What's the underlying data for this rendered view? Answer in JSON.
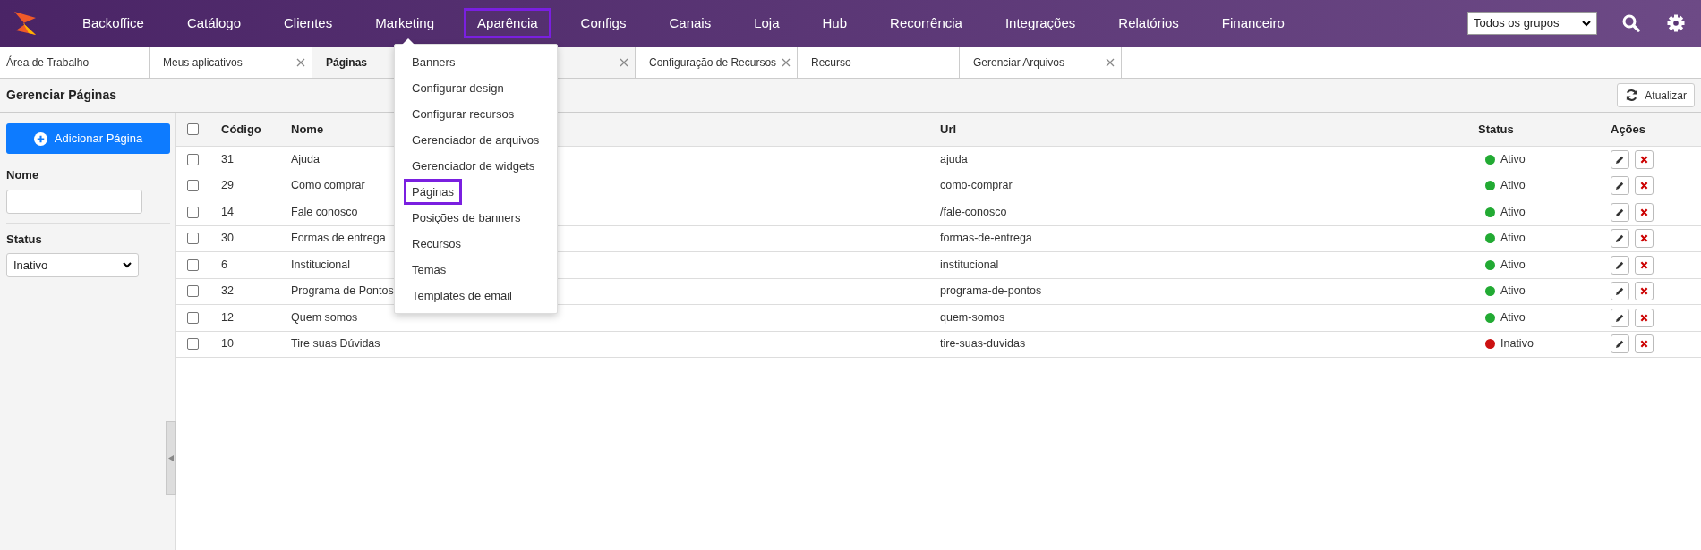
{
  "nav": {
    "items": [
      {
        "label": "Backoffice",
        "selected": false
      },
      {
        "label": "Catálogo",
        "selected": false
      },
      {
        "label": "Clientes",
        "selected": false
      },
      {
        "label": "Marketing",
        "selected": false
      },
      {
        "label": "Aparência",
        "selected": true
      },
      {
        "label": "Configs",
        "selected": false
      },
      {
        "label": "Canais",
        "selected": false
      },
      {
        "label": "Loja",
        "selected": false
      },
      {
        "label": "Hub",
        "selected": false
      },
      {
        "label": "Recorrência",
        "selected": false
      },
      {
        "label": "Integrações",
        "selected": false
      },
      {
        "label": "Relatórios",
        "selected": false
      },
      {
        "label": "Financeiro",
        "selected": false
      }
    ],
    "group_select": "Todos os grupos"
  },
  "tabs": [
    {
      "label": "Área de Trabalho",
      "selected": false,
      "closable": false
    },
    {
      "label": "Meus aplicativos",
      "selected": false,
      "closable": true
    },
    {
      "label": "Páginas",
      "selected": true,
      "closable": true
    },
    {
      "label": "Configuração de Recursos",
      "selected": false,
      "closable": true
    },
    {
      "label": "Recurso",
      "selected": false,
      "closable": false
    },
    {
      "label": "Gerenciar Arquivos",
      "selected": false,
      "closable": true
    }
  ],
  "dropdown_menu": [
    {
      "label": "Banners",
      "selected": false
    },
    {
      "label": "Configurar design",
      "selected": false
    },
    {
      "label": "Configurar recursos",
      "selected": false
    },
    {
      "label": "Gerenciador de arquivos",
      "selected": false
    },
    {
      "label": "Gerenciador de widgets",
      "selected": false
    },
    {
      "label": "Páginas",
      "selected": true
    },
    {
      "label": "Posições de banners",
      "selected": false
    },
    {
      "label": "Recursos",
      "selected": false
    },
    {
      "label": "Temas",
      "selected": false
    },
    {
      "label": "Templates de email",
      "selected": false
    }
  ],
  "page_title": "Gerenciar Páginas",
  "refresh_button": "Atualizar",
  "sidebar": {
    "add_button": "Adicionar Página",
    "name_label": "Nome",
    "status_label": "Status",
    "status_value": "Inativo"
  },
  "table": {
    "all_checked": false,
    "columns": [
      "Código",
      "Nome",
      "Url",
      "Status",
      "Ações"
    ],
    "rows": [
      {
        "code": "31",
        "name": "Ajuda",
        "url": "ajuda",
        "status": "Ativo",
        "color": "#22aa33",
        "checked": false
      },
      {
        "code": "29",
        "name": "Como comprar",
        "url": "como-comprar",
        "status": "Ativo",
        "color": "#22aa33",
        "checked": false
      },
      {
        "code": "14",
        "name": "Fale conosco",
        "url": "/fale-conosco",
        "status": "Ativo",
        "color": "#22aa33",
        "checked": false
      },
      {
        "code": "30",
        "name": "Formas de entrega",
        "url": "formas-de-entrega",
        "status": "Ativo",
        "color": "#22aa33",
        "checked": false
      },
      {
        "code": "6",
        "name": "Institucional",
        "url": "institucional",
        "status": "Ativo",
        "color": "#22aa33",
        "checked": false
      },
      {
        "code": "32",
        "name": "Programa de Pontos",
        "url": "programa-de-pontos",
        "status": "Ativo",
        "color": "#22aa33",
        "checked": false
      },
      {
        "code": "12",
        "name": "Quem somos",
        "url": "quem-somos",
        "status": "Ativo",
        "color": "#22aa33",
        "checked": false
      },
      {
        "code": "10",
        "name": "Tire suas Dúvidas",
        "url": "tire-suas-duvidas",
        "status": "Inativo",
        "color": "#cc1111",
        "checked": false
      }
    ]
  }
}
